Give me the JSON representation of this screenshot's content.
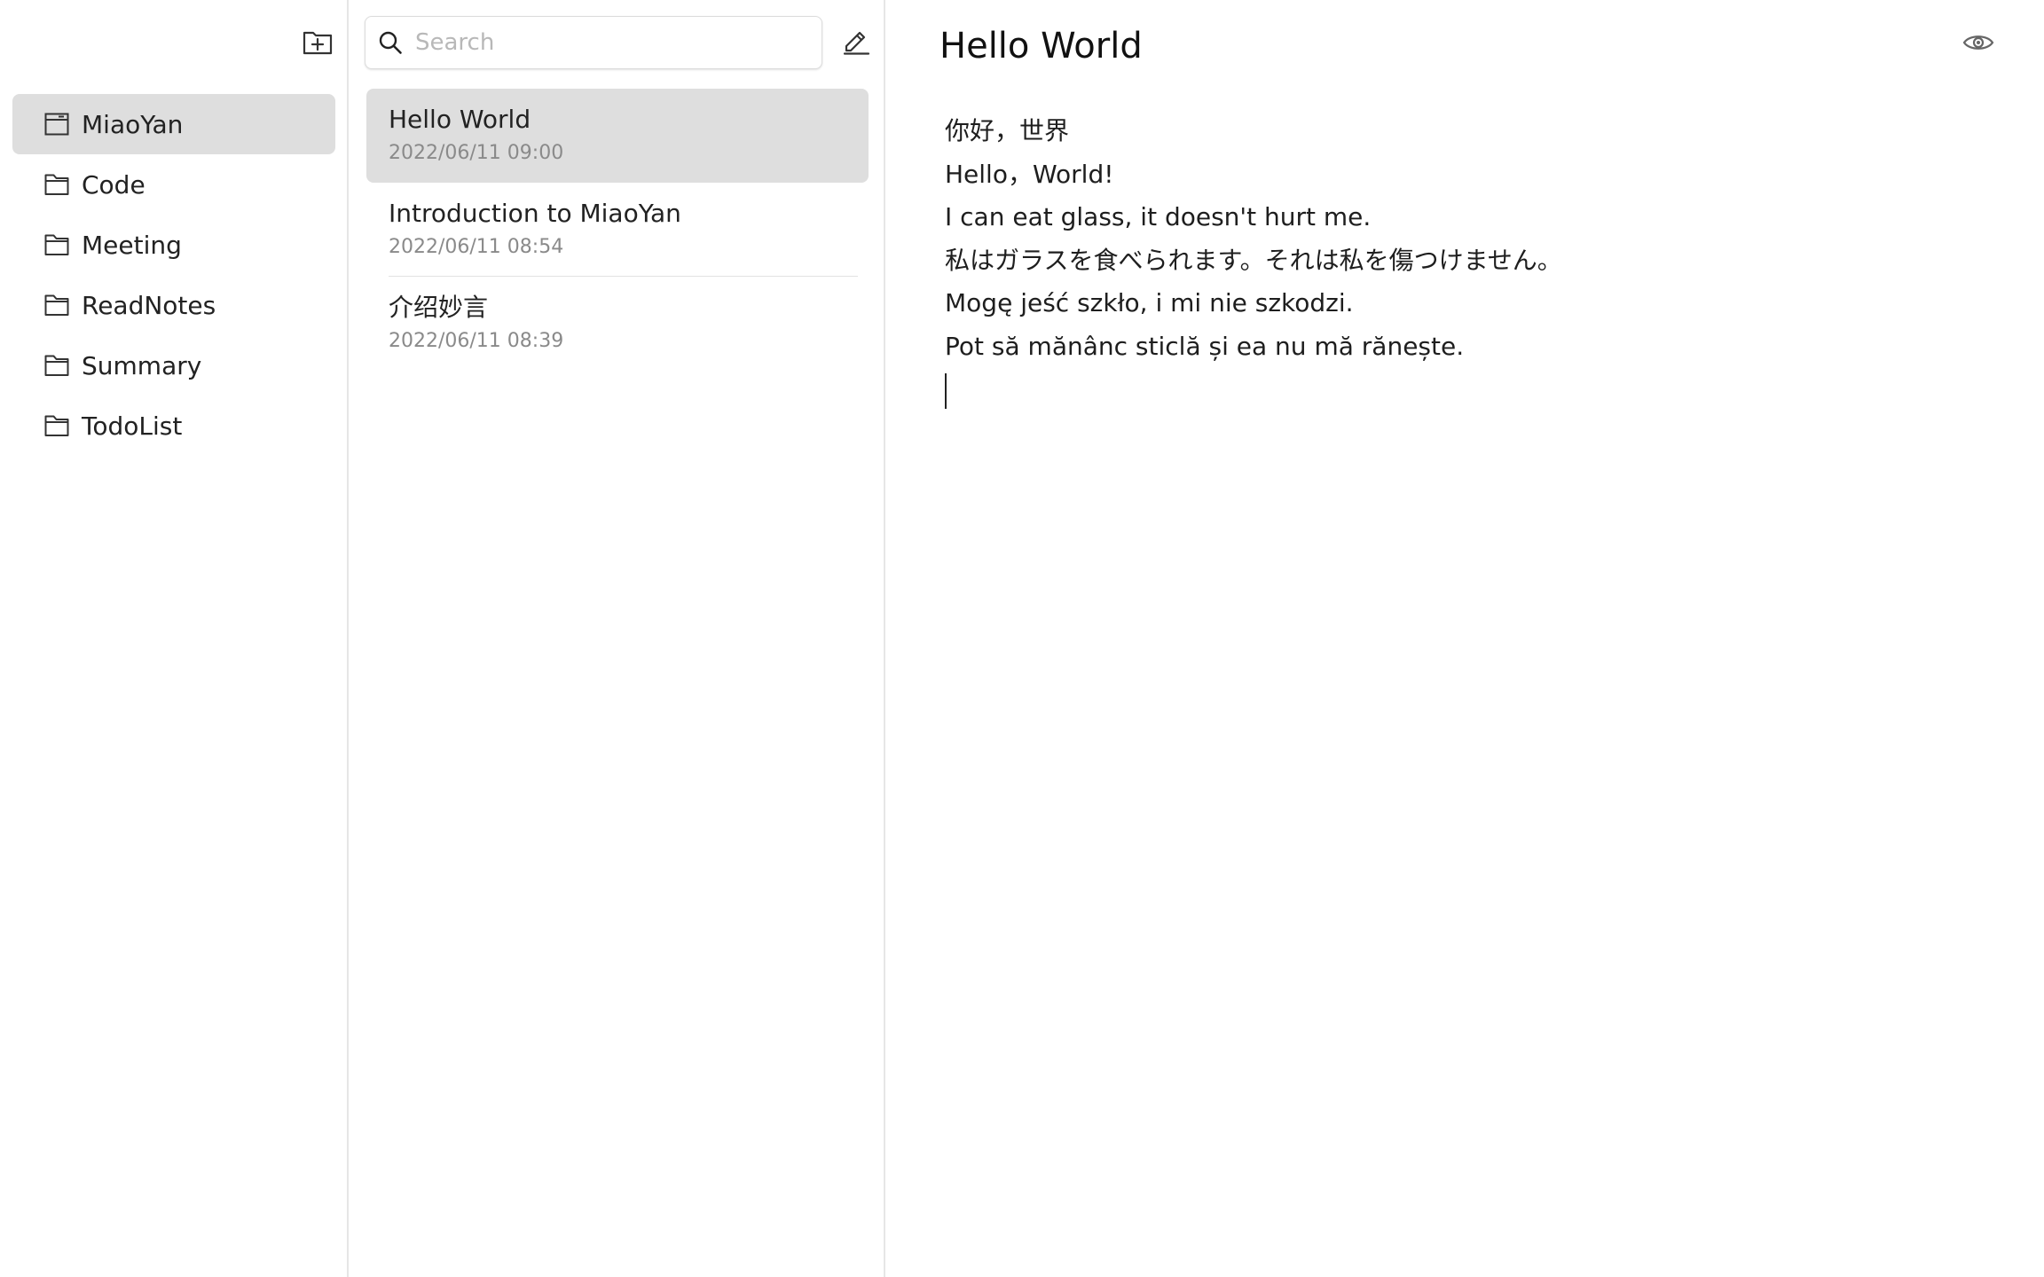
{
  "sidebar": {
    "new_folder_icon": "folder-plus-icon",
    "folders": [
      {
        "label": "MiaoYan",
        "icon": "inbox-icon",
        "active": true
      },
      {
        "label": "Code",
        "icon": "folder-icon",
        "active": false
      },
      {
        "label": "Meeting",
        "icon": "folder-icon",
        "active": false
      },
      {
        "label": "ReadNotes",
        "icon": "folder-icon",
        "active": false
      },
      {
        "label": "Summary",
        "icon": "folder-icon",
        "active": false
      },
      {
        "label": "TodoList",
        "icon": "folder-icon",
        "active": false
      }
    ]
  },
  "notelist": {
    "search": {
      "placeholder": "Search",
      "value": ""
    },
    "compose_icon": "pencil-icon",
    "notes": [
      {
        "title": "Hello World",
        "date": "2022/06/11 09:00",
        "active": true
      },
      {
        "title": "Introduction to MiaoYan",
        "date": "2022/06/11 08:54",
        "active": false
      },
      {
        "title": "介绍妙言",
        "date": "2022/06/11 08:39",
        "active": false
      }
    ]
  },
  "editor": {
    "title": "Hello World",
    "preview_icon": "eye-icon",
    "lines": [
      "你好，世界",
      "Hello，World!",
      "I can eat glass, it doesn't hurt me.",
      "私はガラスを食べられます。それは私を傷つけません。",
      "Mogę jeść szkło, i mi nie szkodzi.",
      "Pot să mănânc sticlă și ea nu mă rănește."
    ]
  },
  "colors": {
    "active_bg": "#dedede",
    "divider": "#e6e6e6",
    "muted_text": "#8a8a8a"
  }
}
